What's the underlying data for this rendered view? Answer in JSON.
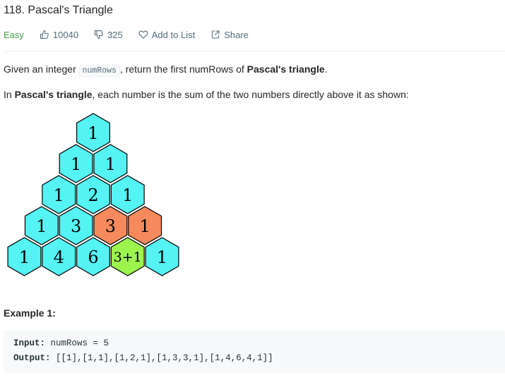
{
  "problem": {
    "title": "118. Pascal's Triangle",
    "difficulty": "Easy",
    "likes": "10040",
    "dislikes": "325",
    "add_to_list": "Add to List",
    "share": "Share"
  },
  "description": {
    "p1_prefix": "Given an integer",
    "p1_code": "numRows",
    "p1_middle": ", return the first numRows of",
    "p1_bold": "Pascal's triangle",
    "p1_suffix": ".",
    "p2_prefix": "In",
    "p2_bold": "Pascal's triangle",
    "p2_suffix": ", each number is the sum of the two numbers directly above it as shown:"
  },
  "triangle": {
    "rows": [
      [
        "1"
      ],
      [
        "1",
        "1"
      ],
      [
        "1",
        "2",
        "1"
      ],
      [
        "1",
        "3",
        "3",
        "1"
      ],
      [
        "1",
        "4",
        "6",
        "3+1",
        "1"
      ]
    ],
    "colors": {
      "default": "#55f3f3",
      "highlight_parent": "#f68a5c",
      "highlight_sum": "#9cf54f",
      "stroke": "#000000"
    }
  },
  "example": {
    "title": "Example 1:",
    "input_label": "Input:",
    "input_value": "numRows = 5",
    "output_label": "Output:",
    "output_value": "[[1],[1,1],[1,2,1],[1,3,3,1],[1,4,6,4,1]]"
  }
}
